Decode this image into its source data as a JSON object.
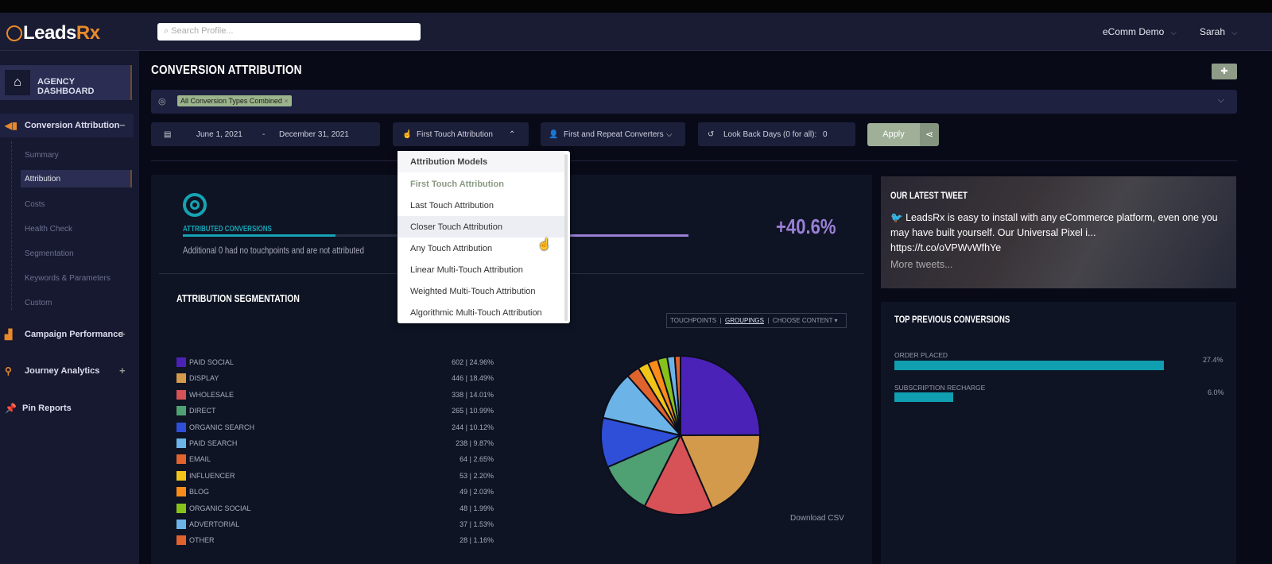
{
  "header": {
    "logo": "LeadsRx",
    "search_placeholder": "Search Profile...",
    "account": "eComm Demo",
    "user": "Sarah"
  },
  "sidebar": {
    "agency": "AGENCY DASHBOARD",
    "sections": [
      {
        "label": "Conversion Attribution",
        "toggle": "−",
        "icon": "megaphone-icon"
      },
      {
        "label": "Campaign Performance",
        "toggle": "+",
        "icon": "bar-chart-icon"
      },
      {
        "label": "Journey Analytics",
        "toggle": "+",
        "icon": "route-icon"
      },
      {
        "label": "Pin Reports",
        "toggle": "",
        "icon": "pin-icon"
      }
    ],
    "subitems": [
      "Summary",
      "Attribution",
      "Costs",
      "Health Check",
      "Segmentation",
      "Keywords & Parameters",
      "Custom"
    ],
    "active": "Attribution"
  },
  "page": {
    "title": "CONVERSION ATTRIBUTION",
    "conversion_tag": "All Conversion Types Combined",
    "tag_close": "×"
  },
  "filters": {
    "start_date": "June 1, 2021",
    "separator": "-",
    "end_date": "December 31, 2021",
    "model": "First Touch Attribution",
    "converters": "First and Repeat Converters",
    "lookback_label": "Look Back Days (0 for all):",
    "lookback_value": "0",
    "apply": "Apply"
  },
  "dropdown": {
    "header": "Attribution Models",
    "items": [
      "First Touch Attribution",
      "Last Touch Attribution",
      "Closer Touch Attribution",
      "Any Touch Attribution",
      "Linear Multi-Touch Attribution",
      "Weighted Multi-Touch Attribution",
      "Algorithmic Multi-Touch Attribution"
    ],
    "selected": "First Touch Attribution",
    "hovered": "Closer Touch Attribution"
  },
  "summary": {
    "label": "ATTRIBUTED CONVERSIONS",
    "note": "Additional 0 had no touchpoints and are not attributed",
    "change": "+40.6%",
    "accent": "#16a3b3",
    "change_color": "#9a7fd6"
  },
  "segmentation": {
    "title": "ATTRIBUTION SEGMENTATION",
    "tabs": [
      "TOUCHPOINTS",
      "GROUPINGS",
      "CHOOSE CONTENT ▾"
    ],
    "active_tab": "GROUPINGS",
    "download": "Download CSV"
  },
  "chart_data": {
    "type": "pie",
    "categories": [
      "PAID SOCIAL",
      "DISPLAY",
      "WHOLESALE",
      "DIRECT",
      "ORGANIC SEARCH",
      "PAID SEARCH",
      "EMAIL",
      "INFLUENCER",
      "BLOG",
      "ORGANIC SOCIAL",
      "ADVERTORIAL",
      "OTHER"
    ],
    "values": [
      602,
      446,
      338,
      265,
      244,
      238,
      64,
      53,
      49,
      48,
      37,
      28
    ],
    "labels": [
      "602 | 24.96%",
      "446 | 18.49%",
      "338 | 14.01%",
      "265 | 10.99%",
      "244 | 10.12%",
      "238 | 9.87%",
      "64 | 2.65%",
      "53 | 2.20%",
      "49 | 2.03%",
      "48 | 1.99%",
      "37 | 1.53%",
      "28 | 1.16%"
    ],
    "colors": [
      "#4b22b8",
      "#d39a4c",
      "#d65256",
      "#4fa072",
      "#2f4fd8",
      "#6cb4e8",
      "#e0632e",
      "#f0c419",
      "#fb8c1a",
      "#86c21a",
      "#6cb4e8",
      "#e0632e"
    ]
  },
  "tweet": {
    "title": "OUR LATEST TWEET",
    "text": "LeadsRx is easy to install with any eCommerce platform, even one you may have built yourself. Our Universal Pixel i...",
    "link": "https://t.co/oVPWvWfhYe",
    "more": "More tweets..."
  },
  "top_conversions": {
    "title": "TOP PREVIOUS CONVERSIONS",
    "items": [
      {
        "label": "ORDER PLACED",
        "value": "27.4%",
        "pct": 27.4
      },
      {
        "label": "SUBSCRIPTION RECHARGE",
        "value": "6.0%",
        "pct": 6.0
      }
    ]
  }
}
